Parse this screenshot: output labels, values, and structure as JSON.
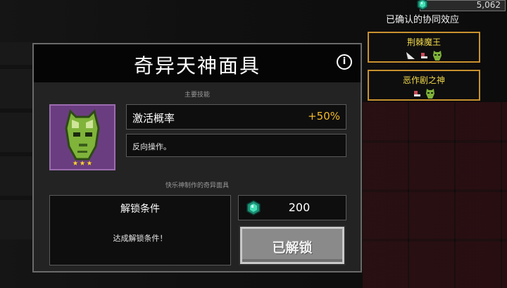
{
  "currency": {
    "amount": "5,062",
    "icon": "gem-icon",
    "color": "#2bd1a0"
  },
  "synergy": {
    "title": "已确认的协同效应",
    "cards": [
      {
        "name": "荆棘魔王",
        "icons": [
          "horn-icon",
          "boot-icon",
          "mask-icon"
        ]
      },
      {
        "name": "恶作剧之神",
        "icons": [
          "boot-icon",
          "mask-icon"
        ]
      }
    ],
    "border_color": "#c8912e",
    "name_color": "#f0d84a"
  },
  "dialog": {
    "title": "奇异天神面具",
    "info_icon": "info-icon",
    "main_skill_label": "主要技能",
    "skill": {
      "name": "激活概率",
      "value": "+50%",
      "value_color": "#f2b928"
    },
    "description": "反向操作。",
    "source_label": "快乐神制作的奇异面具",
    "stars": 3,
    "unlock": {
      "title": "解锁条件",
      "description": "达成解锁条件！"
    },
    "price": {
      "icon": "gem-icon",
      "value": "200"
    },
    "unlocked_button": "已解锁"
  }
}
